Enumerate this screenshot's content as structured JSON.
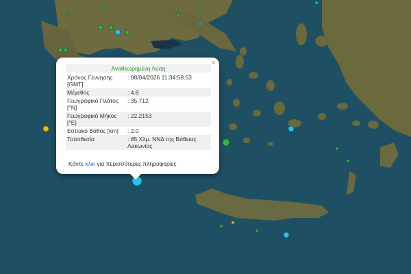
{
  "popup": {
    "title": "Αναθεωρημένη Λύση",
    "close_symbol": "×",
    "rows": [
      {
        "label": "Χρόνος Γέννησης [GMT]",
        "value": ": 08/04/2026 11:34:58.53"
      },
      {
        "label": "Μέγεθος",
        "value": ": 4.8"
      },
      {
        "label": "Γεωγραφικό Πλάτος [°N]",
        "value": ": 35.712"
      },
      {
        "label": "Γεωγραφικό Μήκος [°E]",
        "value": ": 22.2153"
      },
      {
        "label": "Εστιακό Βάθος [km]",
        "value": ": 2.0"
      },
      {
        "label": "Τοποθεσία",
        "value": ": 85 Χλμ. ΝΝΔ της Βάθειας Λακωνίας"
      }
    ],
    "more_prefix": "Κάντε ",
    "more_link": "κλικ",
    "more_suffix": " για περισσότερες πληροφορίες"
  },
  "marker_colors": {
    "recent": "#29c5e6",
    "older": "#3cb44b",
    "yellow": "#e8c020",
    "ocean": "#1f4f63",
    "land": "#6b6a3c"
  },
  "icons": [
    "close-icon",
    "earthquake-marker"
  ]
}
